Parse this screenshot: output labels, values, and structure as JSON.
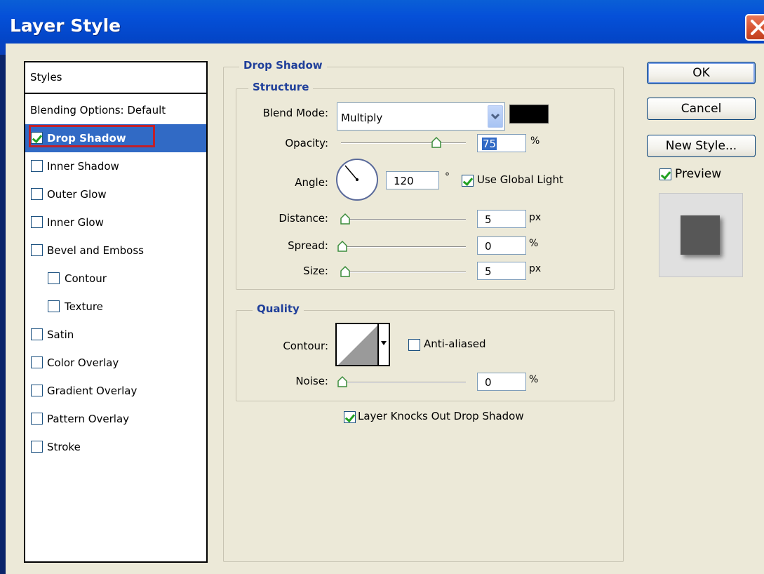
{
  "window": {
    "title": "Layer Style"
  },
  "styles_panel": {
    "header": "Styles",
    "items": [
      {
        "label": "Blending Options: Default",
        "checkbox": false,
        "checked": false,
        "selected": false,
        "indent": 0
      },
      {
        "label": "Drop Shadow",
        "checkbox": true,
        "checked": true,
        "selected": true,
        "indent": 0
      },
      {
        "label": "Inner Shadow",
        "checkbox": true,
        "checked": false,
        "selected": false,
        "indent": 0
      },
      {
        "label": "Outer Glow",
        "checkbox": true,
        "checked": false,
        "selected": false,
        "indent": 0
      },
      {
        "label": "Inner Glow",
        "checkbox": true,
        "checked": false,
        "selected": false,
        "indent": 0
      },
      {
        "label": "Bevel and Emboss",
        "checkbox": true,
        "checked": false,
        "selected": false,
        "indent": 0
      },
      {
        "label": "Contour",
        "checkbox": true,
        "checked": false,
        "selected": false,
        "indent": 1
      },
      {
        "label": "Texture",
        "checkbox": true,
        "checked": false,
        "selected": false,
        "indent": 1
      },
      {
        "label": "Satin",
        "checkbox": true,
        "checked": false,
        "selected": false,
        "indent": 0
      },
      {
        "label": "Color Overlay",
        "checkbox": true,
        "checked": false,
        "selected": false,
        "indent": 0
      },
      {
        "label": "Gradient Overlay",
        "checkbox": true,
        "checked": false,
        "selected": false,
        "indent": 0
      },
      {
        "label": "Pattern Overlay",
        "checkbox": true,
        "checked": false,
        "selected": false,
        "indent": 0
      },
      {
        "label": "Stroke",
        "checkbox": true,
        "checked": false,
        "selected": false,
        "indent": 0
      }
    ]
  },
  "drop_shadow": {
    "title": "Drop Shadow",
    "structure": {
      "title": "Structure",
      "blend_mode_label": "Blend Mode:",
      "blend_mode_value": "Multiply",
      "shadow_color": "#000000",
      "opacity_label": "Opacity:",
      "opacity_value": "75",
      "opacity_unit": "%",
      "opacity_level": 0.75,
      "angle_label": "Angle:",
      "angle_value": "120",
      "angle_unit": "°",
      "use_global_light_label": "Use Global Light",
      "use_global_light_checked": true,
      "distance_label": "Distance:",
      "distance_value": "5",
      "distance_unit": "px",
      "spread_label": "Spread:",
      "spread_value": "0",
      "spread_unit": "%",
      "size_label": "Size:",
      "size_value": "5",
      "size_unit": "px"
    },
    "quality": {
      "title": "Quality",
      "contour_label": "Contour:",
      "anti_aliased_label": "Anti-aliased",
      "anti_aliased_checked": false,
      "noise_label": "Noise:",
      "noise_value": "0",
      "noise_unit": "%"
    },
    "knockout_label": "Layer Knocks Out Drop Shadow",
    "knockout_checked": true
  },
  "buttons": {
    "ok": "OK",
    "cancel": "Cancel",
    "new_style": "New Style..."
  },
  "preview": {
    "label": "Preview",
    "checked": true
  }
}
